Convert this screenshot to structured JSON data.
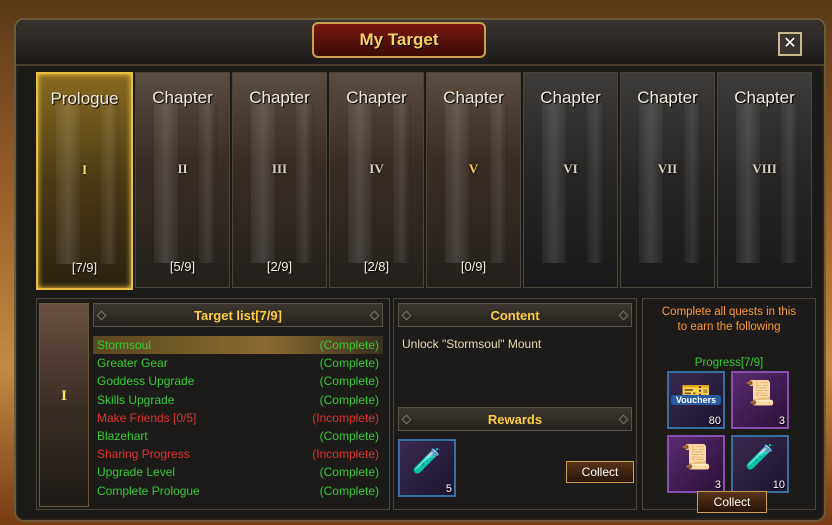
{
  "window": {
    "title": "My Target",
    "close_symbol": "✕"
  },
  "chapters": [
    {
      "title": "Prologue",
      "numeral": "I",
      "progress": "[7/9]",
      "state": "selected"
    },
    {
      "title": "Chapter",
      "numeral": "II",
      "progress": "[5/9]",
      "state": "unlocked"
    },
    {
      "title": "Chapter",
      "numeral": "III",
      "progress": "[2/9]",
      "state": "unlocked"
    },
    {
      "title": "Chapter",
      "numeral": "IV",
      "progress": "[2/8]",
      "state": "unlocked"
    },
    {
      "title": "Chapter",
      "numeral": "V",
      "progress": "[0/9]",
      "state": "unlocked"
    },
    {
      "title": "Chapter",
      "numeral": "VI",
      "progress": "",
      "state": "locked"
    },
    {
      "title": "Chapter",
      "numeral": "VII",
      "progress": "",
      "state": "locked"
    },
    {
      "title": "Chapter",
      "numeral": "VIII",
      "progress": "",
      "state": "locked"
    }
  ],
  "target_panel": {
    "chapter_numeral": "I",
    "heading": "Target list[7/9]",
    "items": [
      {
        "name": "Stormsoul",
        "status": "(Complete)",
        "complete": true
      },
      {
        "name": "Greater Gear",
        "status": "(Complete)",
        "complete": true
      },
      {
        "name": "Goddess Upgrade",
        "status": "(Complete)",
        "complete": true
      },
      {
        "name": "Skills Upgrade",
        "status": "(Complete)",
        "complete": true
      },
      {
        "name": "Make Friends  [0/5]",
        "status": "(Incomplete)",
        "complete": false
      },
      {
        "name": "Blazehart",
        "status": "(Complete)",
        "complete": true
      },
      {
        "name": "Sharing Progress",
        "status": "(Incomplete)",
        "complete": false
      },
      {
        "name": "Upgrade Level",
        "status": "(Complete)",
        "complete": true
      },
      {
        "name": "Complete Prologue",
        "status": "(Complete)",
        "complete": true
      }
    ]
  },
  "content_panel": {
    "heading": "Content",
    "text": "Unlock \"Stormsoul\" Mount",
    "rewards_heading": "Rewards",
    "reward_count": "5",
    "collect_label": "Collect"
  },
  "right_panel": {
    "line1": "Complete all quests in this",
    "line2": "to earn the following",
    "progress": "Progress[7/9]",
    "rewards": [
      {
        "icon": "vouchers-icon",
        "label": "Vouchers",
        "count": "80"
      },
      {
        "icon": "scroll-icon",
        "count": "3"
      },
      {
        "icon": "purple-scroll-icon",
        "count": "3"
      },
      {
        "icon": "potion-icon",
        "count": "10"
      }
    ],
    "collect_label": "Collect"
  },
  "colors": {
    "complete": "#33cc33",
    "incomplete": "#e03030",
    "heading": "#ffcc40",
    "accent": "#ff9a30"
  }
}
